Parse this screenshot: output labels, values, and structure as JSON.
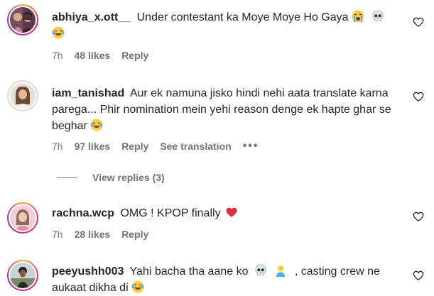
{
  "comments": [
    {
      "username": "abhiya_x.ott__",
      "text": "Under contestant ka Moye Moye Ho Gaya",
      "emojis": [
        "loudly-crying-face",
        "skull",
        "face-with-tears-of-joy"
      ],
      "time": "7h",
      "likes": "48 likes",
      "reply": "Reply"
    },
    {
      "username": "iam_tanishad",
      "text": "Aur ek namuna jisko hindi nehi aata translate karna parega... Phir nomination mein yehi reason denge ek hapte ghar se beghar",
      "emojis": [
        "face-with-tears-of-joy"
      ],
      "time": "7h",
      "likes": "97 likes",
      "reply": "Reply",
      "translation": "See translation",
      "more": "•••"
    },
    {
      "username": "rachna.wcp",
      "text": "OMG ! KPOP finally",
      "emojis": [
        "red-heart"
      ],
      "time": "7h",
      "likes": "28 likes",
      "reply": "Reply"
    },
    {
      "username": "peeyushh003",
      "text_part1": "Yahi bacha tha aane ko",
      "text_part2": ", casting crew ne aukaat dikha di",
      "emojis": [
        "skull",
        "person-facepalming",
        "face-with-tears-of-joy"
      ]
    }
  ],
  "view_replies": "View replies (3)",
  "colors": {
    "text": "#262626",
    "secondary": "#737373",
    "heart_filled": "#ed4956"
  }
}
